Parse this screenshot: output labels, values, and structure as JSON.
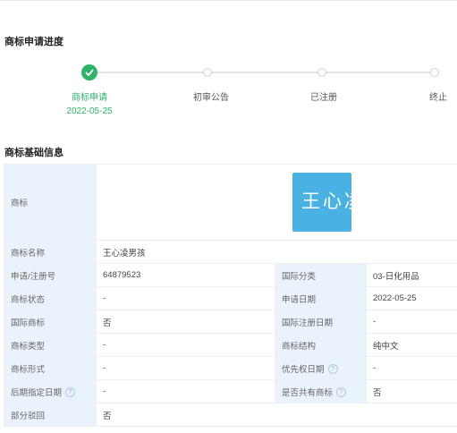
{
  "progress": {
    "title": "商标申请进度",
    "steps": [
      {
        "label": "商标申请",
        "date": "2022-05-25",
        "status": "done"
      },
      {
        "label": "初审公告",
        "date": "",
        "status": "pending"
      },
      {
        "label": "已注册",
        "date": "",
        "status": "pending"
      },
      {
        "label": "终止",
        "date": "",
        "status": "pending"
      }
    ]
  },
  "basic": {
    "title": "商标基础信息",
    "logo_label": "商标",
    "logo_text": "王心凌男",
    "name_label": "商标名称",
    "name_value": "王心凌男孩",
    "rows": [
      {
        "l1": "申请/注册号",
        "v1": "64879523",
        "l2": "国际分类",
        "v2": "03-日化用品"
      },
      {
        "l1": "商标状态",
        "v1": "-",
        "l2": "申请日期",
        "v2": "2022-05-25"
      },
      {
        "l1": "国际商标",
        "v1": "否",
        "l2": "国际注册日期",
        "v2": "-"
      },
      {
        "l1": "商标类型",
        "v1": "-",
        "l2": "商标结构",
        "v2": "纯中文"
      },
      {
        "l1": "商标形式",
        "v1": "-",
        "l2": "优先权日期",
        "v2": "-"
      },
      {
        "l1": "后期指定日期",
        "v1": "-",
        "l2": "是否共有商标",
        "v2": "否"
      }
    ],
    "partial_label": "部分驳回",
    "partial_value": "否",
    "help_icon": "question-circle-icon"
  },
  "colors": {
    "accent": "#2fb36b",
    "logo_bg": "#4ab2e3",
    "label_bg": "#eaf3fc"
  }
}
